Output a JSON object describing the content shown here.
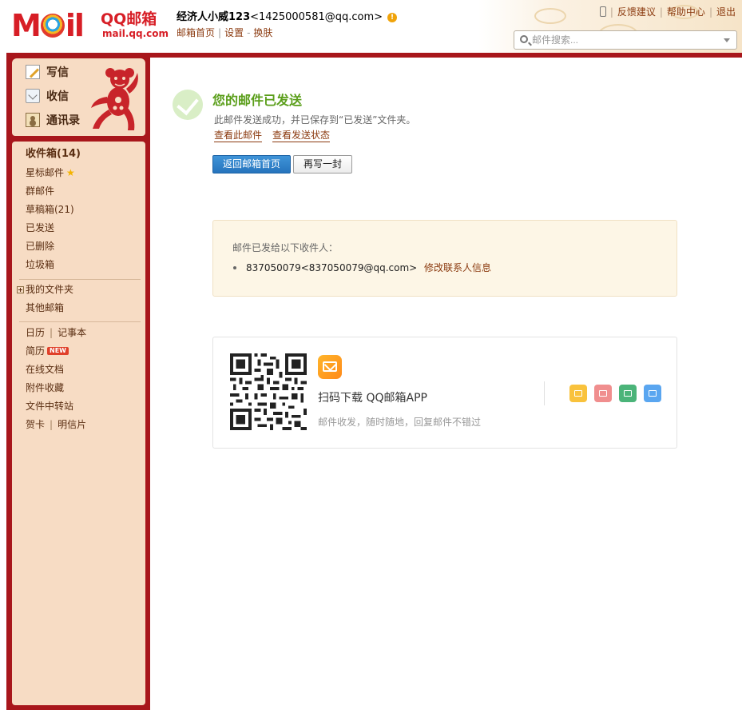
{
  "header": {
    "logo_text_prefix": "M",
    "logo_text_suffix": "il",
    "logo_brand_cn": "QQ邮箱",
    "logo_domain": "mail.qq.com",
    "user_name": "经济人小威123",
    "user_email": "<1425000581@qq.com>",
    "alert_symbol": "!",
    "links": [
      "邮箱首页",
      "设置",
      "换肤"
    ],
    "top_right_links": [
      "反馈建议",
      "帮助中心",
      "退出"
    ],
    "search_placeholder": "邮件搜索..."
  },
  "sidebar": {
    "actions": [
      {
        "label": "写信",
        "icon": "write-icon"
      },
      {
        "label": "收信",
        "icon": "inbox-icon"
      },
      {
        "label": "通讯录",
        "icon": "contacts-icon"
      }
    ],
    "folders": {
      "inbox": "收件箱(14)",
      "starred": "星标邮件",
      "starred_icon": "★",
      "group": "群邮件",
      "drafts": "草稿箱(21)",
      "sent": "已发送",
      "deleted": "已删除",
      "spam": "垃圾箱"
    },
    "my_folders": "我的文件夹",
    "other_mailboxes": "其他邮箱",
    "tools": {
      "calendar": "日历",
      "notes": "记事本",
      "resume": "简历",
      "new_badge": "NEW",
      "online_docs": "在线文档",
      "attachments": "附件收藏",
      "file_transfer": "文件中转站",
      "greeting_card": "贺卡",
      "postcard": "明信片"
    }
  },
  "main": {
    "success_title": "您的邮件已发送",
    "success_desc": "此邮件发送成功，并已保存到“已发送”文件夹。",
    "link_view": "查看此邮件",
    "link_status": "查看发送状态",
    "btn_back": "返回邮箱首页",
    "btn_rewrite": "再写一封",
    "recipient_head": "邮件已发给以下收件人：",
    "recipient_addr": "837050079<837050079@qq.com>",
    "recipient_edit": "修改联系人信息",
    "app_title": "扫码下载 QQ邮箱APP",
    "app_sub": "邮件收发，随时随地，回复邮件不错过",
    "app_icons": [
      {
        "name": "mail-app-icon",
        "color": "#f9c23c"
      },
      {
        "name": "calendar-app-icon",
        "color": "#f08e8e"
      },
      {
        "name": "notes-app-icon",
        "color": "#4bb479"
      },
      {
        "name": "file-transfer-app-icon",
        "color": "#5aa6f0"
      }
    ]
  },
  "colors": {
    "frame": "#a8161b",
    "sidebar_bg": "#f7dcc4",
    "success_green": "#5a9e1a",
    "primary_button": "#2a7cc7",
    "link_brown": "#8b3a0f"
  }
}
